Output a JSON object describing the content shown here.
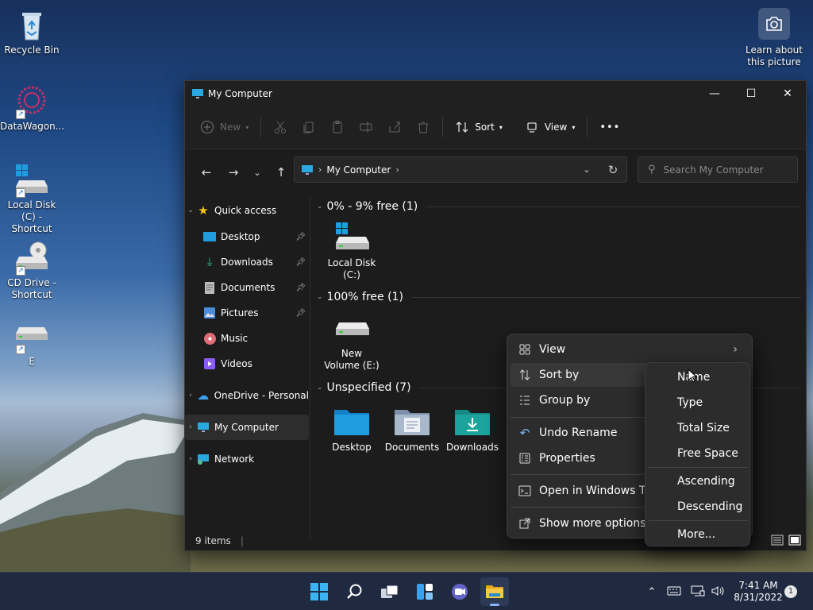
{
  "desktop": {
    "icons": [
      {
        "label": "Recycle Bin",
        "icon": "recycle-bin-icon"
      },
      {
        "label": "DataWagon...",
        "icon": "app-shortcut-icon"
      },
      {
        "label": "Local Disk (C) - Shortcut",
        "icon": "drive-shortcut-icon"
      },
      {
        "label": "CD Drive - Shortcut",
        "icon": "cd-drive-shortcut-icon"
      },
      {
        "label": "E",
        "icon": "drive-shortcut-icon"
      }
    ],
    "learn_label": "Learn about this picture",
    "learn_icon": "camera-icon"
  },
  "window": {
    "title": "My Computer",
    "controls": {
      "minimize": "—",
      "maximize": "☐",
      "close": "✕"
    }
  },
  "toolbar": {
    "new_label": "New",
    "sort_label": "Sort",
    "view_label": "View",
    "more_label": "•••"
  },
  "address": {
    "location": "My Computer",
    "search_placeholder": "Search My Computer"
  },
  "nav": {
    "quick_access": "Quick access",
    "pinned": [
      {
        "label": "Desktop",
        "icon": "desktop-folder-icon",
        "pinned": true
      },
      {
        "label": "Downloads",
        "icon": "download-icon",
        "pinned": true
      },
      {
        "label": "Documents",
        "icon": "documents-icon",
        "pinned": true
      },
      {
        "label": "Pictures",
        "icon": "pictures-icon",
        "pinned": true
      },
      {
        "label": "Music",
        "icon": "music-icon",
        "pinned": false
      },
      {
        "label": "Videos",
        "icon": "videos-icon",
        "pinned": false
      }
    ],
    "onedrive": "OneDrive - Personal",
    "my_computer": "My Computer",
    "network": "Network"
  },
  "groups": [
    {
      "label": "0% - 9% free (1)",
      "items": [
        {
          "label": "Local Disk (C:)",
          "icon": "system-drive-icon"
        }
      ]
    },
    {
      "label": "100% free (1)",
      "items": [
        {
          "label": "New Volume (E:)",
          "icon": "drive-icon"
        }
      ]
    },
    {
      "label": "Unspecified (7)",
      "items": [
        {
          "label": "Desktop",
          "icon": "desktop-folder-icon"
        },
        {
          "label": "Documents",
          "icon": "documents-folder-icon"
        },
        {
          "label": "Downloads",
          "icon": "downloads-folder-icon"
        }
      ]
    }
  ],
  "status": {
    "items": "9 items"
  },
  "context_menu": {
    "view": "View",
    "sort_by": "Sort by",
    "group_by": "Group by",
    "undo_rename": "Undo Rename",
    "properties": "Properties",
    "open_terminal": "Open in Windows Terminal",
    "more_options": "Show more options"
  },
  "sort_submenu": {
    "name": "Name",
    "type": "Type",
    "total_size": "Total Size",
    "free_space": "Free Space",
    "ascending": "Ascending",
    "descending": "Descending",
    "more": "More..."
  },
  "taskbar": {
    "time": "7:41 AM",
    "date": "8/31/2022",
    "notifications": "1"
  },
  "colors": {
    "accent": "#0078d4",
    "folder_teal": "#1ba39c",
    "folder_blue": "#1e9de0"
  }
}
